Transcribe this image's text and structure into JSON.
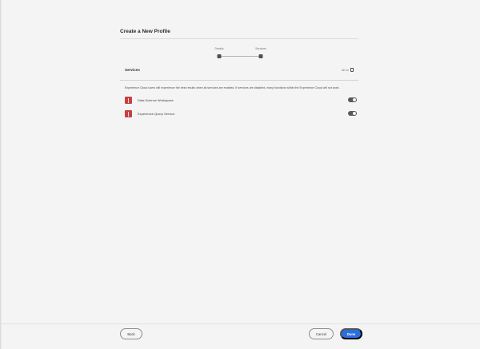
{
  "header": {
    "title": "Create a New Profile"
  },
  "stepper": {
    "steps": [
      "Details",
      "Services"
    ]
  },
  "section": {
    "title": "Services",
    "meta": "All on"
  },
  "description": "Experience Cloud users will experience the best results when all services are enabled. If services are disabled, many functions within the Experience Cloud will not work.",
  "services": [
    {
      "label": "Data Science Workspace",
      "enabled": true
    },
    {
      "label": "Experience Query Service",
      "enabled": true
    }
  ],
  "footer": {
    "back_label": "Back",
    "cancel_label": "Cancel",
    "done_label": "Done"
  },
  "colors": {
    "primary": "#2b6fdd",
    "service_icon": "#c64240",
    "toggle_on": "#595959"
  }
}
